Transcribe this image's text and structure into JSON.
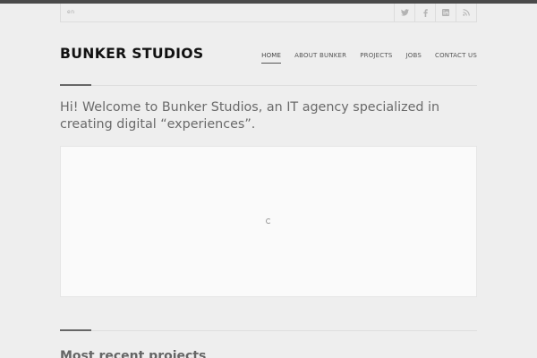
{
  "topbar": {
    "lang": "en",
    "socials": [
      {
        "icon": "twitter-icon"
      },
      {
        "icon": "facebook-icon"
      },
      {
        "icon": "linkedin-icon"
      },
      {
        "icon": "rss-icon"
      }
    ]
  },
  "header": {
    "logo": "BUNKER STUDIOS",
    "nav": [
      {
        "label": "HOME",
        "active": true
      },
      {
        "label": "ABOUT BUNKER"
      },
      {
        "label": "PROJECTS"
      },
      {
        "label": "JOBS"
      },
      {
        "label": "CONTACT US"
      }
    ]
  },
  "main": {
    "intro": "Hi! Welcome to Bunker Studios, an IT agency specialized in creating digital “experiences”.",
    "section_title": "Most recent projects"
  },
  "colors": {
    "background": "#eeeeee",
    "top_rule": "#4a4a4a",
    "logo": "#111111",
    "text": "#666666"
  }
}
